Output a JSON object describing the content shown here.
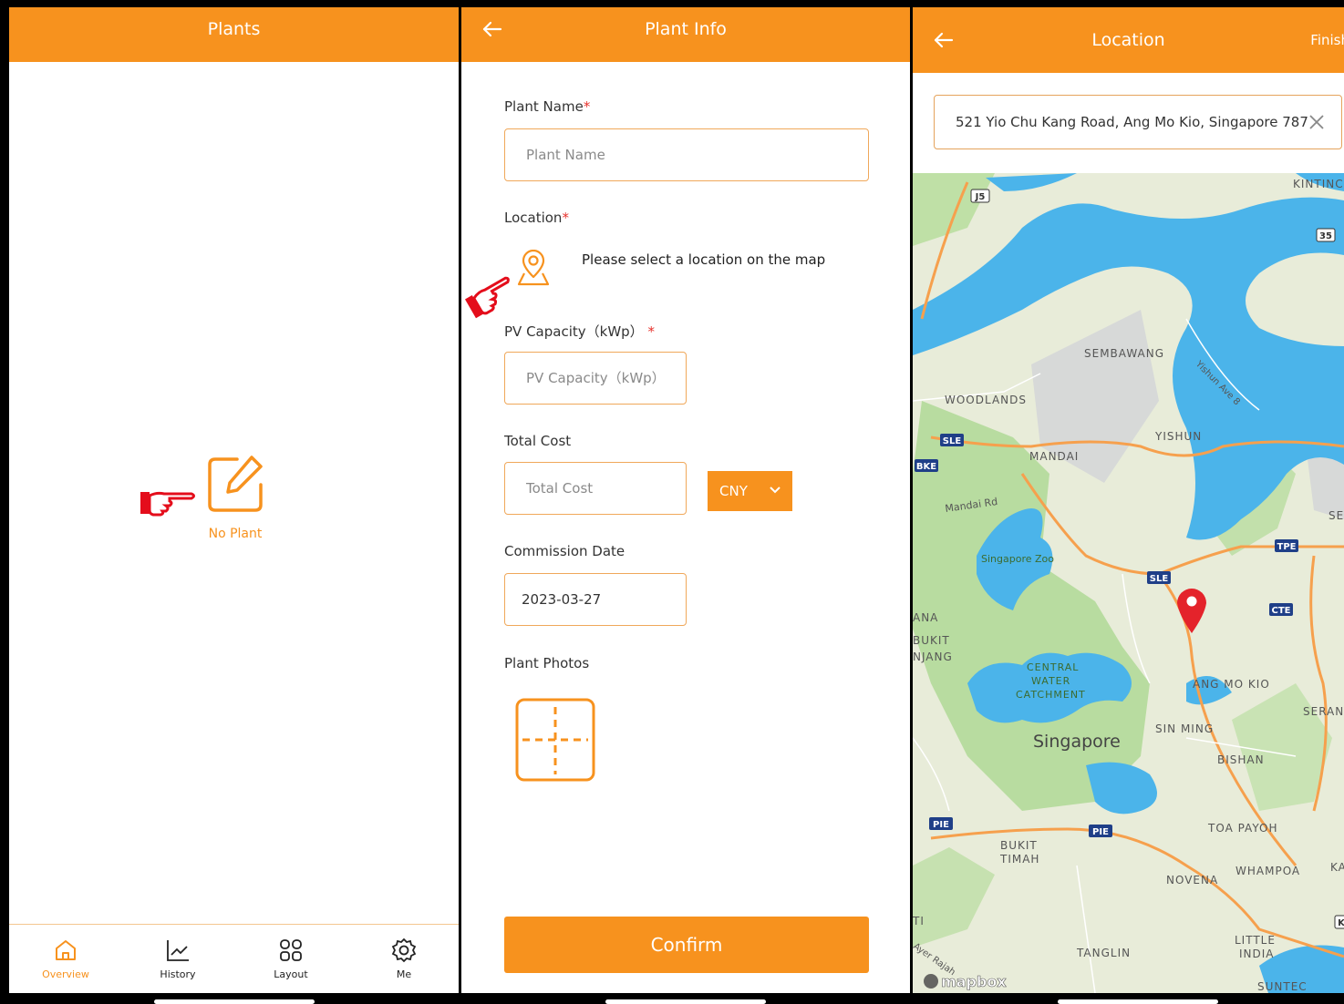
{
  "plants_screen": {
    "title": "Plants",
    "empty_label": "No Plant",
    "nav": [
      {
        "label": "Overview",
        "icon": "home-icon",
        "active": true
      },
      {
        "label": "History",
        "icon": "chart-line-icon",
        "active": false
      },
      {
        "label": "Layout",
        "icon": "grid-icon",
        "active": false
      },
      {
        "label": "Me",
        "icon": "gear-icon",
        "active": false
      }
    ]
  },
  "plant_info_screen": {
    "title": "Plant Info",
    "required_mark": "*",
    "plant_name": {
      "label": "Plant Name",
      "placeholder": "Plant Name"
    },
    "location": {
      "label": "Location",
      "hint": "Please select a location on the map"
    },
    "pv_capacity": {
      "label": "PV Capacity（kWp）",
      "placeholder": "PV Capacity（kWp）"
    },
    "total_cost": {
      "label": "Total Cost",
      "placeholder": "Total Cost",
      "currency": "CNY"
    },
    "commission_date": {
      "label": "Commission Date",
      "value": "2023-03-27"
    },
    "plant_photos": {
      "label": "Plant Photos"
    },
    "confirm_label": "Confirm"
  },
  "location_screen": {
    "title": "Location",
    "finish_label": "Finish",
    "search_value": "521 Yio Chu Kang Road, Ang Mo Kio, Singapore 787",
    "map_labels": {
      "sembawang": "SEMBAWANG",
      "woodlands": "WOODLANDS",
      "yishun": "YISHUN",
      "mandai": "MANDAI",
      "mandai_rd": "Mandai Rd",
      "yishun_ave": "Yishun Ave 8",
      "zoo": "Singapore Zoo",
      "central": "CENTRAL",
      "water": "WATER",
      "catchment": "CATCHMENT",
      "singapore": "Singapore",
      "sin_ming": "SIN MING",
      "ang_mo_kio": "ANG MO KIO",
      "bishan": "BISHAN",
      "toa_payoh": "TOA PAYOH",
      "bukit": "BUKIT",
      "timah": "TIMAH",
      "novena": "NOVENA",
      "whampoa": "WHAMPOA",
      "tanglin": "TANGLIN",
      "little": "LITTLE",
      "india": "INDIA",
      "suntec": "SUNTEC",
      "serang": "SERAN",
      "se": "SE",
      "kintinc": "KINTINC",
      "ana": "ANA",
      "bukit_left": "BUKIT",
      "njang": "NJANG",
      "ka": "KA",
      "ti": "TI",
      "ayer_rajah": "Ayer Rajah",
      "mapbox": "mapbox",
      "shields": {
        "j5": "J5",
        "r35": "35",
        "sle": "SLE",
        "bke": "BKE",
        "sle2": "SLE",
        "tpe": "TPE",
        "cte": "CTE",
        "pie": "PIE",
        "pie2": "PIE",
        "k": "K"
      }
    }
  },
  "colors": {
    "primary": "#f7921e",
    "required": "#e7322d",
    "water": "#4bb4ea",
    "land": "#e8ecd9",
    "park": "#b8dca0",
    "marker": "#e4232b"
  }
}
